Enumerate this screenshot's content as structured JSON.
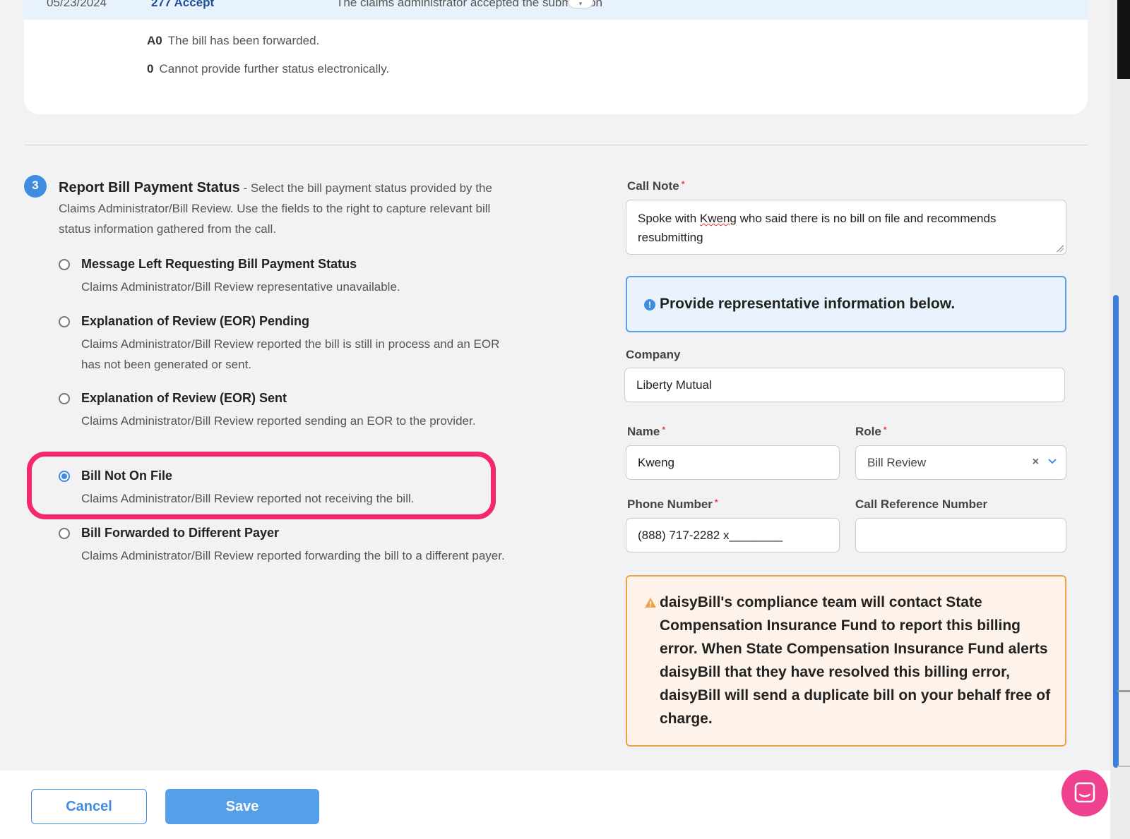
{
  "top_row": {
    "date": "05/23/2024",
    "code": "277 Accept",
    "description": "The claims administrator accepted the submission"
  },
  "status_lines": [
    {
      "code": "A0",
      "text": "The bill has been forwarded."
    },
    {
      "code": "0",
      "text": "Cannot provide further status electronically."
    }
  ],
  "step": {
    "number": "3",
    "title": "Report Bill Payment Status",
    "description": " - Select the bill payment status provided by the Claims Administrator/Bill Review. Use the fields to the right to capture relevant bill status information gathered from the call."
  },
  "options": [
    {
      "title": "Message Left Requesting Bill Payment Status",
      "description": "Claims Administrator/Bill Review representative unavailable.",
      "selected": false
    },
    {
      "title": "Explanation of Review (EOR) Pending",
      "description": "Claims Administrator/Bill Review reported the bill is still in process and an EOR has not been generated or sent.",
      "selected": false
    },
    {
      "title": "Explanation of Review (EOR) Sent",
      "description": "Claims Administrator/Bill Review reported sending an EOR to the provider.",
      "selected": false
    },
    {
      "title": "Bill Not On File",
      "description": "Claims Administrator/Bill Review reported not receiving the bill.",
      "selected": true
    },
    {
      "title": "Bill Forwarded to Different Payer",
      "description": "Claims Administrator/Bill Review reported forwarding the bill to a different payer.",
      "selected": false
    }
  ],
  "form": {
    "call_note": {
      "label": "Call Note",
      "required": "*",
      "value_before": "Spoke with ",
      "value_misspelled": "Kweng",
      "value_after": " who said there is no bill on file and recommends resubmitting"
    },
    "info_message": "Provide representative information below.",
    "company": {
      "label": "Company",
      "value": "Liberty Mutual"
    },
    "name": {
      "label": "Name",
      "required": "*",
      "value": "Kweng"
    },
    "role": {
      "label": "Role",
      "required": "*",
      "value": "Bill Review",
      "clear": "×"
    },
    "phone": {
      "label": "Phone Number",
      "required": "*",
      "value": "(888) 717-2282 x________"
    },
    "call_reference": {
      "label": "Call Reference Number",
      "value": ""
    },
    "warning": "daisyBill's compliance team will contact State Compensation Insurance Fund to report this billing error. When State Compensation Insurance Fund alerts daisyBill that they have resolved this billing error, daisyBill will send a duplicate bill on your behalf free of charge."
  },
  "footer": {
    "cancel_label": "Cancel",
    "save_label": "Save"
  },
  "colors": {
    "accent": "#3f8de0",
    "highlight": "#f5286c",
    "warning_border": "#f0a04c",
    "chat": "#f0418e"
  },
  "icons": {
    "info": "info-circle-icon",
    "warning": "warning-triangle-icon",
    "chevron": "chevron-down-icon",
    "chat": "chat-bubble-icon"
  }
}
